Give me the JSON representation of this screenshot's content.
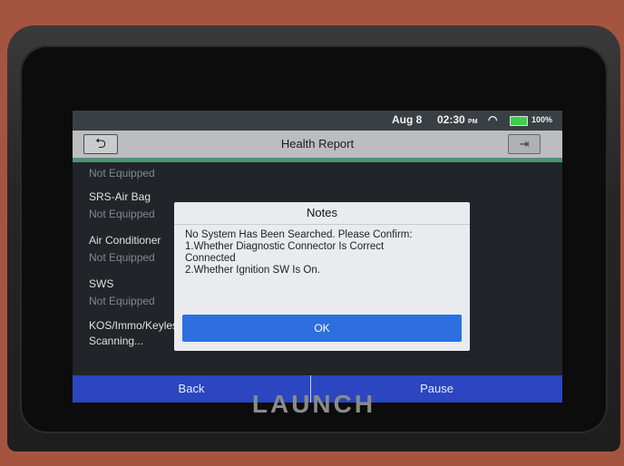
{
  "status_bar": {
    "date": "Aug 8",
    "time": "02:30",
    "ampm": "PM",
    "battery": "100%"
  },
  "header": {
    "title": "Health Report",
    "back_icon": "back-arrow-icon",
    "exit_icon": "exit-icon"
  },
  "systems": [
    {
      "name": "",
      "status": "Not Equipped"
    },
    {
      "name": "SRS-Air Bag",
      "status": "Not Equipped"
    },
    {
      "name": "Air Conditioner",
      "status": "Not Equipped"
    },
    {
      "name": "SWS",
      "status": "Not Equipped"
    },
    {
      "name": "KOS/Immo/Keyless",
      "status": "Scanning..."
    }
  ],
  "dialog": {
    "title": "Notes",
    "line1": "No System Has Been Searched. Please Confirm:",
    "line2": " 1.Whether Diagnostic Connector Is Correct",
    "line3": "Connected",
    "line4": " 2.Whether Ignition SW Is On.",
    "ok_label": "OK"
  },
  "bottom_bar": {
    "back_label": "Back",
    "pause_label": "Pause"
  },
  "brand": "LAUNCH",
  "colors": {
    "accent": "#5aa585",
    "primary_button": "#2e6fe0",
    "bottom_bar": "#2b46c0"
  }
}
